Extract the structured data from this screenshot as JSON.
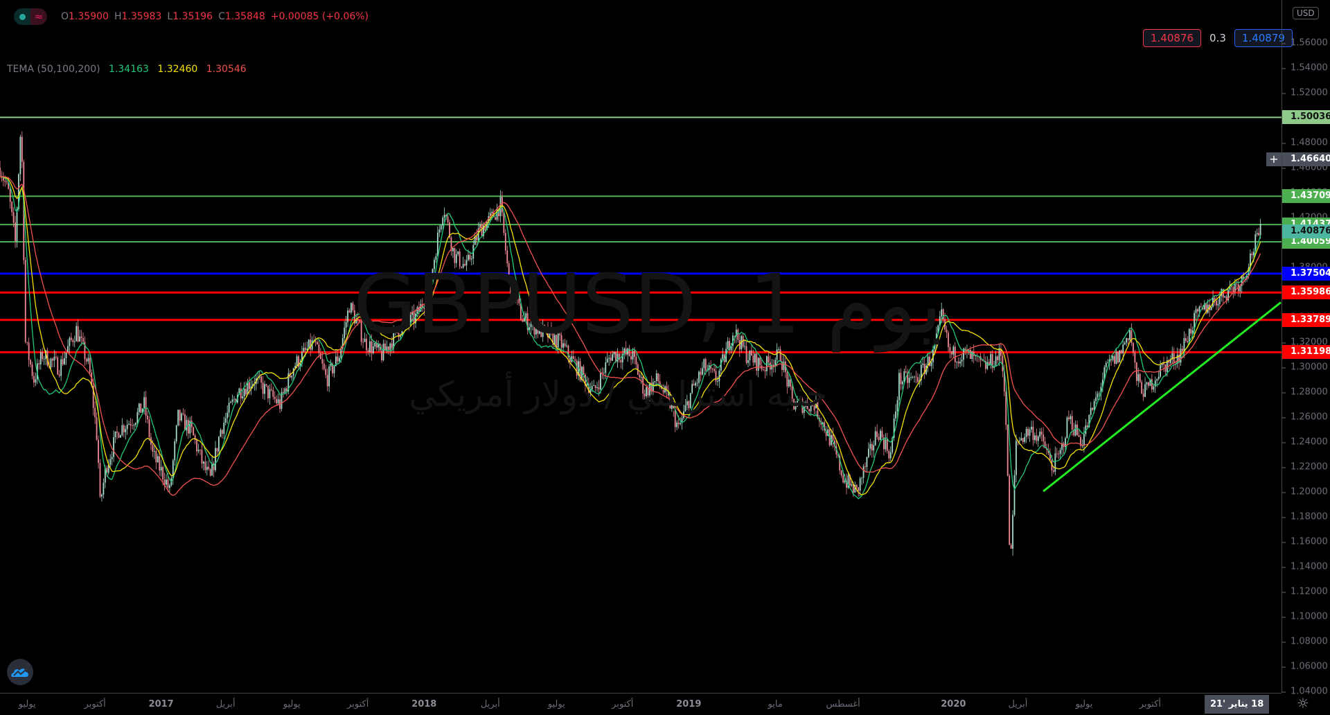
{
  "legend": {
    "toggle_icon": "wave-icon",
    "ohlc": [
      {
        "k": "O",
        "v": "1.35900"
      },
      {
        "k": "H",
        "v": "1.35983"
      },
      {
        "k": "L",
        "v": "1.35196"
      },
      {
        "k": "C",
        "v": "1.35848"
      }
    ],
    "change": "+0.00085 (+0.06%)",
    "indicator_name": "TEMA (50,100,200)",
    "indicator_values": [
      "1.34163",
      "1.32460",
      "1.30546"
    ]
  },
  "trade": {
    "sell": "1.40876",
    "spread": "0.3",
    "buy": "1.40879"
  },
  "watermark": {
    "symbol": "GBPUSD, 1 يوم",
    "description": "جنيه استرليني / دولار أمريكي"
  },
  "price_axis": {
    "currency": "USD",
    "crosshair": "1.46640",
    "plus": "+"
  },
  "time_axis": {
    "current": "18 يناير '21",
    "settings_icon": "☼"
  },
  "colors": {
    "background": "#000000",
    "up": "#a8dccf",
    "down": "#f08a97",
    "tema": [
      "#22c97a",
      "#f5e10a",
      "#f0524f"
    ],
    "sell": "#f23645",
    "buy": "#2962ff"
  },
  "chart_data": {
    "type": "candlestick",
    "symbol": "GBPUSD",
    "y_ticks": [
      "1.04000",
      "1.06000",
      "1.08000",
      "1.10000",
      "1.12000",
      "1.14000",
      "1.16000",
      "1.18000",
      "1.20000",
      "1.22000",
      "1.24000",
      "1.26000",
      "1.28000",
      "1.30000",
      "1.32000",
      "1.34000",
      "1.36000",
      "1.38000",
      "1.40000",
      "1.42000",
      "1.44000",
      "1.46000",
      "1.48000",
      "1.50000",
      "1.52000",
      "1.54000",
      "1.56000"
    ],
    "ylim": [
      1.04,
      1.56
    ],
    "x_ticks": [
      {
        "label": "يوليو",
        "t": 32
      },
      {
        "label": "أكتوبر",
        "t": 112
      },
      {
        "label": "2017",
        "t": 190,
        "year": true
      },
      {
        "label": "أبريل",
        "t": 266
      },
      {
        "label": "يوليو",
        "t": 344
      },
      {
        "label": "أكتوبر",
        "t": 422
      },
      {
        "label": "2018",
        "t": 500,
        "year": true
      },
      {
        "label": "أبريل",
        "t": 578
      },
      {
        "label": "يوليو",
        "t": 656
      },
      {
        "label": "أكتوبر",
        "t": 734
      },
      {
        "label": "2019",
        "t": 812,
        "year": true
      },
      {
        "label": "مايو",
        "t": 914
      },
      {
        "label": "أغسطس",
        "t": 994
      },
      {
        "label": "2020",
        "t": 1124,
        "year": true
      },
      {
        "label": "أبريل",
        "t": 1200
      },
      {
        "label": "يوليو",
        "t": 1278
      },
      {
        "label": "أكتوبر",
        "t": 1356
      }
    ],
    "price_path": [
      [
        0,
        1.46
      ],
      [
        10,
        1.44
      ],
      [
        18,
        1.4
      ],
      [
        25,
        1.5
      ],
      [
        30,
        1.32
      ],
      [
        40,
        1.29
      ],
      [
        50,
        1.31
      ],
      [
        70,
        1.3
      ],
      [
        90,
        1.33
      ],
      [
        105,
        1.3
      ],
      [
        115,
        1.24
      ],
      [
        118,
        1.19
      ],
      [
        125,
        1.22
      ],
      [
        140,
        1.25
      ],
      [
        160,
        1.26
      ],
      [
        170,
        1.27
      ],
      [
        180,
        1.23
      ],
      [
        195,
        1.21
      ],
      [
        200,
        1.2
      ],
      [
        210,
        1.26
      ],
      [
        225,
        1.25
      ],
      [
        240,
        1.22
      ],
      [
        248,
        1.21
      ],
      [
        260,
        1.25
      ],
      [
        280,
        1.28
      ],
      [
        300,
        1.29
      ],
      [
        330,
        1.27
      ],
      [
        345,
        1.3
      ],
      [
        370,
        1.32
      ],
      [
        385,
        1.29
      ],
      [
        400,
        1.31
      ],
      [
        412,
        1.35
      ],
      [
        430,
        1.32
      ],
      [
        450,
        1.31
      ],
      [
        470,
        1.33
      ],
      [
        490,
        1.34
      ],
      [
        505,
        1.36
      ],
      [
        515,
        1.4
      ],
      [
        523,
        1.43
      ],
      [
        535,
        1.39
      ],
      [
        550,
        1.38
      ],
      [
        565,
        1.41
      ],
      [
        580,
        1.42
      ],
      [
        590,
        1.43
      ],
      [
        600,
        1.37
      ],
      [
        615,
        1.34
      ],
      [
        635,
        1.33
      ],
      [
        660,
        1.32
      ],
      [
        680,
        1.3
      ],
      [
        700,
        1.28
      ],
      [
        720,
        1.31
      ],
      [
        745,
        1.31
      ],
      [
        760,
        1.28
      ],
      [
        775,
        1.29
      ],
      [
        790,
        1.27
      ],
      [
        800,
        1.25
      ],
      [
        815,
        1.28
      ],
      [
        830,
        1.3
      ],
      [
        845,
        1.29
      ],
      [
        865,
        1.33
      ],
      [
        880,
        1.31
      ],
      [
        900,
        1.3
      ],
      [
        920,
        1.31
      ],
      [
        935,
        1.27
      ],
      [
        960,
        1.27
      ],
      [
        980,
        1.24
      ],
      [
        995,
        1.21
      ],
      [
        1010,
        1.2
      ],
      [
        1020,
        1.22
      ],
      [
        1035,
        1.25
      ],
      [
        1050,
        1.23
      ],
      [
        1060,
        1.29
      ],
      [
        1080,
        1.29
      ],
      [
        1100,
        1.31
      ],
      [
        1110,
        1.34
      ],
      [
        1120,
        1.31
      ],
      [
        1140,
        1.31
      ],
      [
        1160,
        1.3
      ],
      [
        1180,
        1.31
      ],
      [
        1185,
        1.28
      ],
      [
        1190,
        1.16
      ],
      [
        1192,
        1.15
      ],
      [
        1198,
        1.24
      ],
      [
        1215,
        1.25
      ],
      [
        1230,
        1.24
      ],
      [
        1240,
        1.22
      ],
      [
        1250,
        1.23
      ],
      [
        1260,
        1.26
      ],
      [
        1275,
        1.24
      ],
      [
        1290,
        1.27
      ],
      [
        1305,
        1.3
      ],
      [
        1320,
        1.31
      ],
      [
        1332,
        1.33
      ],
      [
        1340,
        1.29
      ],
      [
        1350,
        1.28
      ],
      [
        1370,
        1.3
      ],
      [
        1390,
        1.31
      ],
      [
        1410,
        1.34
      ],
      [
        1425,
        1.35
      ],
      [
        1445,
        1.36
      ],
      [
        1465,
        1.37
      ],
      [
        1480,
        1.4
      ],
      [
        1486,
        1.408
      ]
    ],
    "indicator": {
      "name": "TEMA",
      "periods": [
        50,
        100,
        200
      ]
    },
    "horizontal_lines": [
      {
        "price": 1.50036,
        "label": "1.50036",
        "color": "#8fc98a",
        "text": "#111111"
      },
      {
        "price": 1.43709,
        "label": "1.43709",
        "color": "#4caf50",
        "text": "#ffffff"
      },
      {
        "price": 1.41437,
        "label": "1.41437",
        "color": "#4caf50",
        "text": "#ffffff"
      },
      {
        "price": 1.40059,
        "label": "1.40059",
        "color": "#4caf50",
        "text": "#ffffff"
      },
      {
        "price": 1.37504,
        "label": "1.37504",
        "color": "#0000ff",
        "text": "#ffffff"
      },
      {
        "price": 1.35986,
        "label": "1.35986",
        "color": "#ff0000",
        "text": "#ffffff"
      },
      {
        "price": 1.33789,
        "label": "1.33789",
        "color": "#ff0000",
        "text": "#ffffff"
      },
      {
        "price": 1.31198,
        "label": "1.31198",
        "color": "#ff0000",
        "text": "#ffffff"
      }
    ],
    "last_price": {
      "price": 1.40876,
      "label": "1.40876",
      "color": "#4db6a0"
    },
    "crosshair_price": 1.4664,
    "trendline": {
      "from": [
        1230,
        1.2005
      ],
      "to": [
        1510,
        1.352
      ],
      "color": "#22ee22"
    }
  }
}
